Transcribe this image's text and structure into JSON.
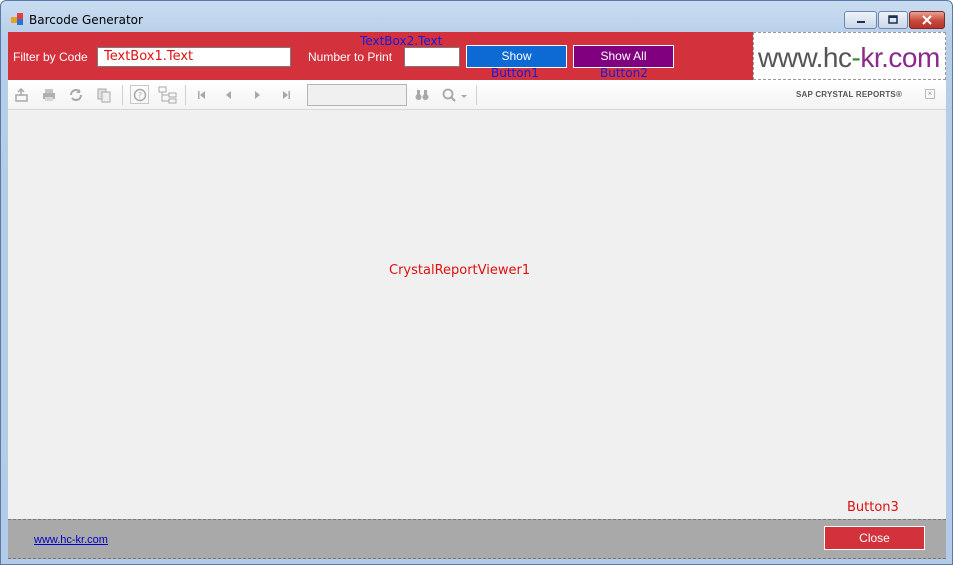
{
  "window": {
    "title": "Barcode Generator"
  },
  "filter": {
    "label": "Filter by Code",
    "value": "TextBox1.Text"
  },
  "print": {
    "label": "Number to Print",
    "designer_name": "TextBox2.Text",
    "value": ""
  },
  "buttons": {
    "show_label": "Show",
    "show_designer_name": "Button1",
    "showall_label": "Show All",
    "showall_designer_name": "Button2",
    "close_label": "Close",
    "close_designer_name": "Button3"
  },
  "logo": {
    "www": "www.",
    "hc": "hc",
    "dash": "-",
    "kr": "kr.com"
  },
  "toolbar": {
    "icons": [
      "export-icon",
      "print-icon",
      "refresh-icon",
      "copy-icon",
      "help-icon",
      "group-tree-icon",
      "first-page-icon",
      "previous-page-icon",
      "next-page-icon",
      "last-page-icon",
      "find-icon",
      "zoom-icon"
    ],
    "page_value": "",
    "brand": "SAP CRYSTAL REPORTS®"
  },
  "viewer": {
    "designer_name": "CrystalReportViewer1"
  },
  "footer": {
    "link": "www.hc-kr.com"
  },
  "colors": {
    "panel_red": "#d3313c",
    "show_blue": "#0d6ad4",
    "showall_purple": "#800080",
    "footer_gray": "#a9a9a9"
  }
}
